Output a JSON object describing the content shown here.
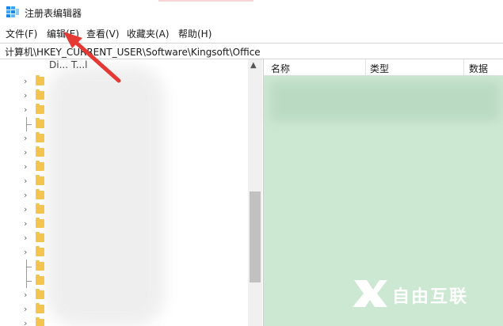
{
  "window": {
    "title": "注册表编辑器"
  },
  "menu": [
    {
      "label": "文件(F)"
    },
    {
      "label": "编辑(E)"
    },
    {
      "label": "查看(V)"
    },
    {
      "label": "收藏夹(A)"
    },
    {
      "label": "帮助(H)"
    }
  ],
  "address": {
    "path": "计算机\\HKEY_CURRENT_USER\\Software\\Kingsoft\\Office"
  },
  "tree": {
    "first_item_partial": "Di... T...l"
  },
  "list": {
    "columns": [
      "名称",
      "类型",
      "数据"
    ]
  },
  "watermark": {
    "text": "自由互联"
  },
  "colors": {
    "list_bg": "#cce7d2",
    "folder": "#f3c44f",
    "arrow": "#e53935"
  }
}
